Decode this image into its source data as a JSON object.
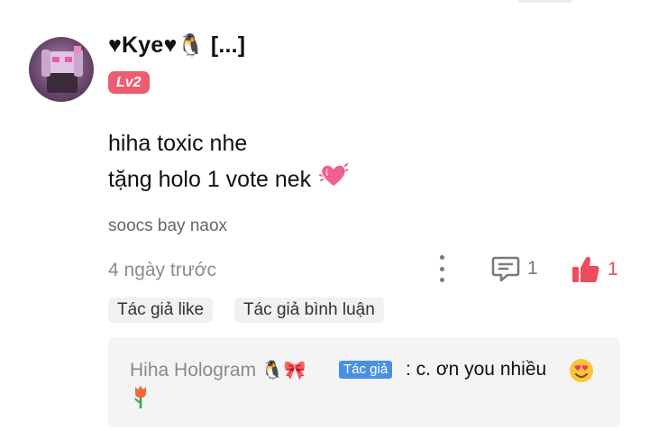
{
  "comment": {
    "username": "♥Kye♥",
    "username_emoji": "🐧",
    "username_truncation": "[...]",
    "level": "Lv2",
    "text_line1": "hiha toxic nhe",
    "text_line2": "tặng holo 1 vote nek",
    "text_emoji": "💓",
    "signature": "soocs bay naox",
    "time": "4 ngày trước",
    "reply_count": "1",
    "like_count": "1",
    "tags": [
      "Tác giả like",
      "Tác giả bình luận"
    ]
  },
  "reply": {
    "author": "Hiha Hologram",
    "author_emojis": "🐧🎀",
    "author_badge": "Tác giả",
    "text": ": c. ơn you nhiều",
    "emojis": [
      "😍",
      "🌷"
    ]
  },
  "colors": {
    "accent_red": "#ec5d70",
    "like_red": "#ec4d5c",
    "author_badge_blue": "#4a90e2",
    "reply_bg": "#f4f4f4",
    "tag_bg": "#f1f1f1"
  },
  "icons": [
    "more-vertical-icon",
    "comment-icon",
    "thumbs-up-icon",
    "heart-emoji",
    "smiling-heart-eyes-emoji",
    "tulip-emoji"
  ]
}
